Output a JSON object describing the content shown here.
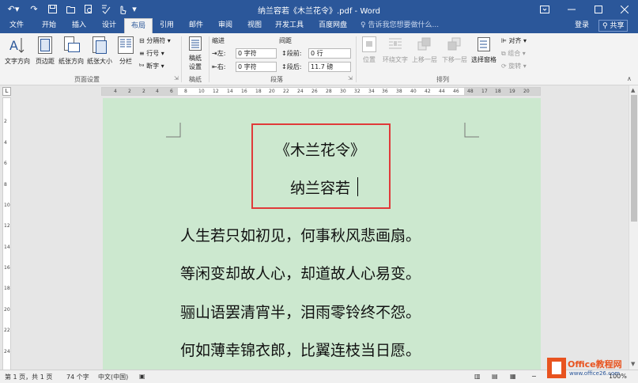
{
  "window": {
    "title": "纳兰容若《木兰花令》.pdf - Word",
    "controls": [
      "restore-ribbon",
      "minimize",
      "maximize",
      "close"
    ]
  },
  "quick_access": [
    "undo-icon",
    "save-icon",
    "print-preview-icon",
    "touch-mode-icon",
    "customize-icon"
  ],
  "tabs": [
    "文件",
    "开始",
    "插入",
    "设计",
    "布局",
    "引用",
    "邮件",
    "审阅",
    "视图",
    "开发工具",
    "百度网盘"
  ],
  "active_tab": "布局",
  "tell_me": "告诉我您想要做什么...",
  "account": {
    "login": "登录",
    "share": "共享"
  },
  "ribbon": {
    "page_setup": {
      "buttons": [
        "文字方向",
        "页边距",
        "纸张方向",
        "纸张大小",
        "分栏"
      ],
      "small": [
        "分隔符",
        "行号",
        "断字"
      ],
      "label": "页面设置"
    },
    "draft": {
      "button": "稿纸设置",
      "button_line1": "稿纸",
      "button_line2": "设置",
      "label": "稿纸"
    },
    "paragraph": {
      "indent_title": "缩进",
      "spacing_title": "间距",
      "left_label": "左:",
      "left_value": "0 字符",
      "right_label": "右:",
      "right_value": "0 字符",
      "before_label": "段前:",
      "before_value": "0 行",
      "after_label": "段后:",
      "after_value": "11.7 磅",
      "label": "段落"
    },
    "arrange": {
      "buttons": [
        "位置",
        "环绕文字",
        "上移一层",
        "下移一层",
        "选择窗格"
      ],
      "small": [
        "对齐",
        "组合",
        "旋转"
      ],
      "label": "排列"
    }
  },
  "ruler_numbers": [
    "4",
    "2",
    "2",
    "4",
    "6",
    "8",
    "10",
    "12",
    "14",
    "16",
    "18",
    "20",
    "22",
    "24",
    "26",
    "28",
    "30",
    "32",
    "34",
    "36",
    "38",
    "40",
    "42",
    "44",
    "46",
    "48",
    "17",
    "18",
    "19",
    "20"
  ],
  "vruler_numbers": [
    "2",
    "4",
    "6",
    "8",
    "10",
    "12",
    "14",
    "16",
    "18",
    "20",
    "22",
    "24"
  ],
  "document": {
    "title": "《木兰花令》",
    "author": "纳兰容若",
    "lines": [
      "人生若只如初见，何事秋风悲画扇。",
      "等闲变却故人心，却道故人心易变。",
      "骊山语罢清宵半，泪雨零铃终不怨。",
      "何如薄幸锦衣郎，比翼连枝当日愿。"
    ],
    "highlight_color": "#e03a3a",
    "page_color": "#cce8cf"
  },
  "status": {
    "page": "第 1 页，共 1 页",
    "words": "74 个字",
    "language": "中文(中国)",
    "zoom": "100%"
  },
  "watermark": {
    "brand": "Office教程网",
    "url": "www.office26.com"
  }
}
